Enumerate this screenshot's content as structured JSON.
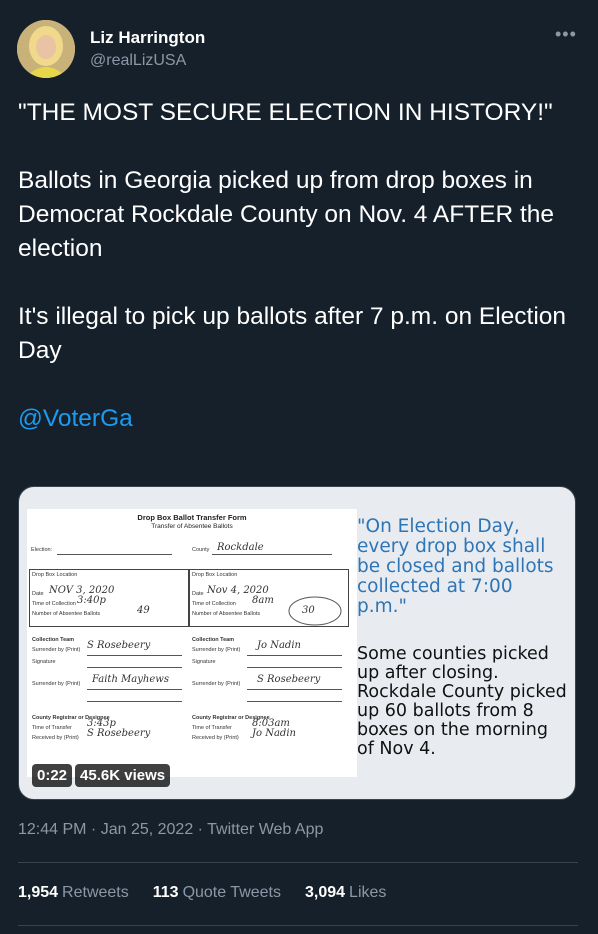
{
  "author": {
    "name": "Liz Harrington",
    "handle": "@realLizUSA"
  },
  "more_icon": "more-dots-icon",
  "tweet": {
    "line1": "\"THE MOST SECURE ELECTION IN HISTORY!\"",
    "line2": "Ballots in Georgia picked up from drop boxes in Democrat Rockdale County on Nov. 4 AFTER the election",
    "line3": "It's illegal to pick up ballots after 7 p.m. on Election Day",
    "mention": "@VoterGa"
  },
  "media": {
    "form": {
      "title": "Drop Box Ballot Transfer Form",
      "subtitle": "Transfer of Absentee Ballots",
      "left_col": {
        "election_label": "Election:",
        "county_label": "County",
        "county_value": "Rockdale",
        "location_label": "Drop Box Location",
        "date_label": "Date",
        "date_value": "NOV 3, 2020",
        "time_label": "Time of Collection",
        "time_value": "3:40p",
        "number_label": "Number of Absentee Ballots",
        "number_value": "49",
        "team_label": "Collection Team",
        "surrender_label": "Surrender by (Print)",
        "surrender_value": "S Rosebeery",
        "signature_label": "Signature",
        "surrender2_label": "Surrender by (Print)",
        "surrender2_value": "Faith Mayhews",
        "registrar_label": "County Registrar or Designee",
        "transfer_label": "Time of Transfer",
        "transfer_value": "3:43p",
        "received_label": "Received by (Print)",
        "received_value": "S Rosebeery"
      },
      "right_col": {
        "location_label": "Drop Box Location",
        "date_label": "Date",
        "date_value": "Nov 4, 2020",
        "time_label": "Time of Collection",
        "time_value": "8am",
        "number_label": "Number of Absentee Ballots",
        "number_value": "30",
        "team_label": "Collection Team",
        "surrender_label": "Surrender by (Print)",
        "surrender_value": "Jo Nadin",
        "signature_label": "Signature",
        "surrender2_label": "Surrender by (Print)",
        "surrender2_value": "S Rosebeery",
        "registrar_label": "County Registrar or Designee",
        "transfer_label": "Time of Transfer",
        "transfer_value": "8:03am",
        "received_label": "Received by (Print)",
        "received_value": "Jo Nadin"
      }
    },
    "quote": "\"On Election Day, every drop box shall be closed and ballots collected at 7:00 p.m.\"",
    "note": "Some counties picked up after closing.  Rockdale County picked up 60 ballots from 8 boxes on the morning of Nov 4.",
    "duration": "0:22",
    "views": "45.6K views"
  },
  "meta": "12:44 PM · Jan 25, 2022 · Twitter Web App",
  "stats": {
    "retweets_count": "1,954",
    "retweets_label": "Retweets",
    "quotes_count": "113",
    "quotes_label": "Quote Tweets",
    "likes_count": "3,094",
    "likes_label": "Likes"
  },
  "colors": {
    "background": "#15202b",
    "link": "#1d9bf0",
    "secondary_text": "#8b98a5",
    "quote_blue": "#2e75b6"
  }
}
